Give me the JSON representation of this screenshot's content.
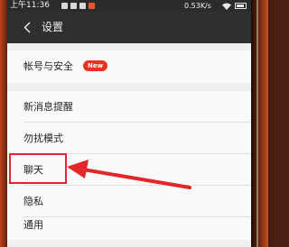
{
  "status_bar": {
    "time": "上午11:36",
    "speed": "0.53K/s",
    "icons": [
      "message-icon",
      "media-icon",
      "notification-icon",
      "shopping-icon",
      "wifi-icon",
      "battery-icon"
    ]
  },
  "header": {
    "back_icon": "back-chevron-icon",
    "title": "设置"
  },
  "settings": {
    "account_security": {
      "label": "帐号与安全",
      "badge": "New"
    },
    "new_message_alert": {
      "label": "新消息提醒"
    },
    "do_not_disturb": {
      "label": "勿扰模式"
    },
    "chat": {
      "label": "聊天"
    },
    "privacy": {
      "label": "隐私"
    },
    "general": {
      "label": "通用"
    }
  },
  "annotation": {
    "color": "#e3262a",
    "target": "chat"
  },
  "colors": {
    "header_bg": "#2f2f2f",
    "badge": "#e9321f"
  }
}
